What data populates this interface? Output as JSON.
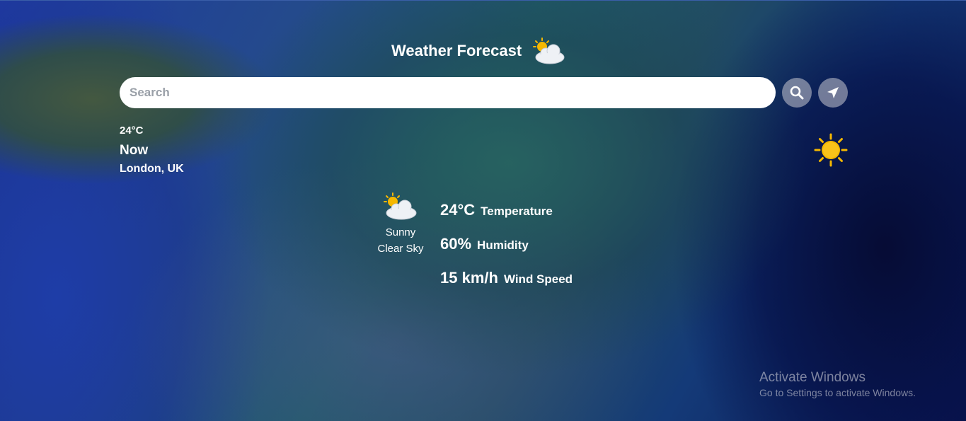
{
  "header": {
    "title": "Weather Forecast",
    "icon": "sun-behind-cloud-icon"
  },
  "search": {
    "placeholder": "Search",
    "value": ""
  },
  "buttons": {
    "search_icon": "magnifier-icon",
    "locate_icon": "location-arrow-icon"
  },
  "current": {
    "temperature": "24°C",
    "time": "Now",
    "location": "London, UK"
  },
  "condition": {
    "icon": "sun-behind-cloud-icon",
    "line1": "Sunny",
    "line2": "Clear Sky"
  },
  "stats": [
    {
      "value": "24°C",
      "label": "Temperature"
    },
    {
      "value": "60%",
      "label": "Humidity"
    },
    {
      "value": "15 km/h",
      "label": "Wind Speed"
    }
  ],
  "decor": {
    "sun_icon": "sun-icon",
    "sun_color": "#f5b800"
  },
  "watermark": {
    "line1": "Activate Windows",
    "line2": "Go to Settings to activate Windows."
  }
}
